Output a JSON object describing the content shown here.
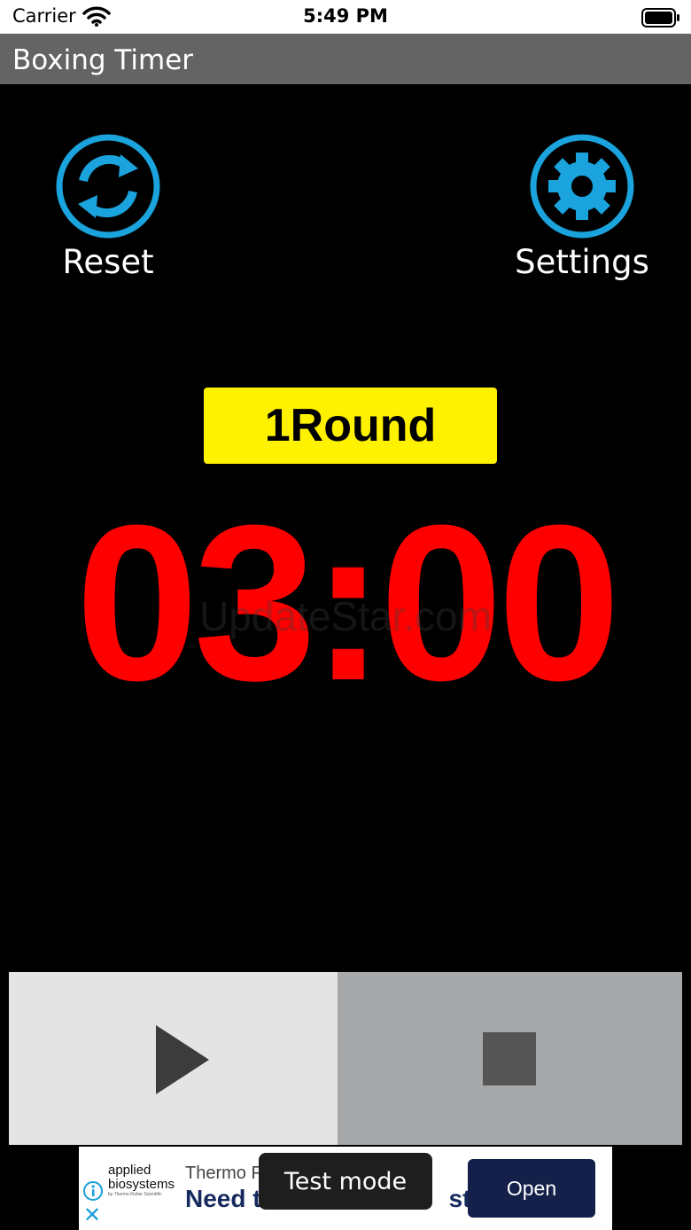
{
  "status_bar": {
    "carrier": "Carrier",
    "time": "5:49 PM",
    "wifi_icon": "wifi-icon",
    "battery_icon": "battery-icon"
  },
  "app": {
    "title": "Boxing Timer"
  },
  "controls_top": {
    "reset_label": "Reset",
    "reset_icon": "refresh-icon",
    "settings_label": "Settings",
    "settings_icon": "gear-icon"
  },
  "round": {
    "number": "1",
    "label": "Round"
  },
  "timer": {
    "display": "03:00"
  },
  "watermark": "UpdateStar.com",
  "playback": {
    "play_icon": "play-icon",
    "stop_icon": "stop-icon"
  },
  "ad": {
    "brand_line1": "applied",
    "brand_line2": "biosystems",
    "brand_line3": "by Thermo Fisher Scientific",
    "headline": "Thermo Fi",
    "cta_text": "Need t",
    "cta_text_end": "st",
    "open_button": "Open",
    "info_icon": "info-icon",
    "close_icon": "close-icon"
  },
  "toast": "Test mode",
  "colors": {
    "accent": "#1aa3dc",
    "round_badge": "#fff200",
    "timer": "#ff0000",
    "title_bar": "#646464",
    "ad_button": "#14204a"
  }
}
